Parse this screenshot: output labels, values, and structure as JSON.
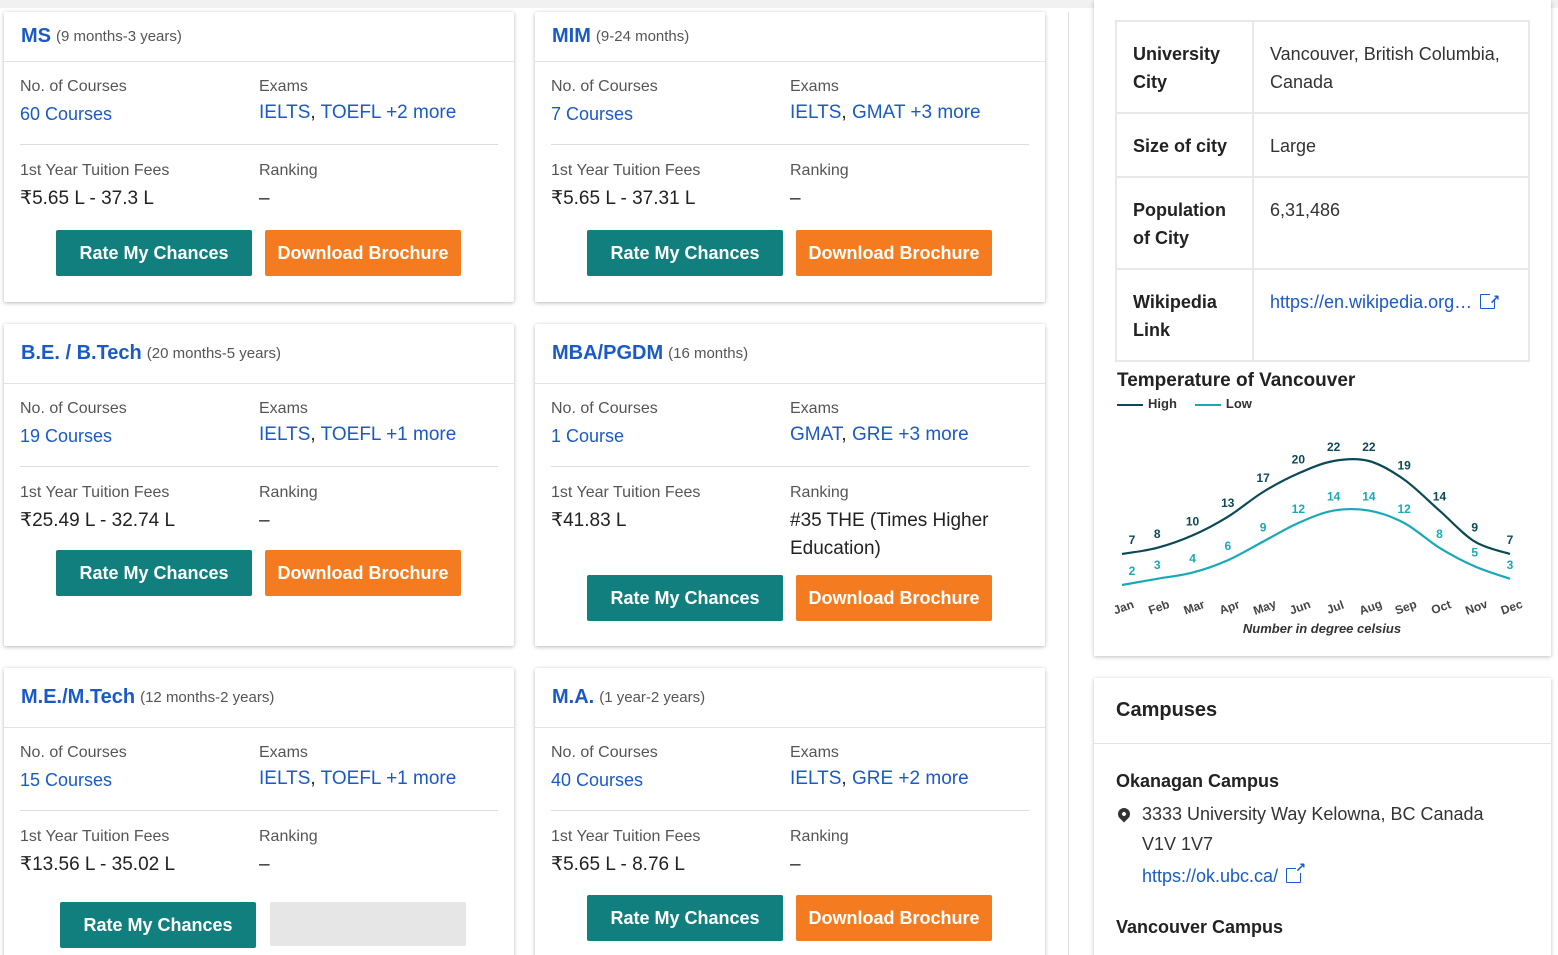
{
  "labels": {
    "no_courses": "No. of Courses",
    "exams": "Exams",
    "fees": "1st Year Tuition Fees",
    "ranking": "Ranking",
    "rate": "Rate My Chances",
    "brochure": "Download Brochure",
    "sep": ", "
  },
  "courses": [
    {
      "title": "MS",
      "duration": "(9 months-3 years)",
      "courses": "60 Courses",
      "exam1": "IELTS",
      "exam2": "TOEFL",
      "more": "+2 more",
      "fees": "₹5.65 L - 37.3 L",
      "ranking": "–"
    },
    {
      "title": "MIM",
      "duration": "(9-24 months)",
      "courses": "7 Courses",
      "exam1": "IELTS",
      "exam2": "GMAT",
      "more": "+3 more",
      "fees": "₹5.65 L - 37.31 L",
      "ranking": "–"
    },
    {
      "title": "B.E. / B.Tech",
      "duration": "(20 months-5 years)",
      "courses": "19 Courses",
      "exam1": "IELTS",
      "exam2": "TOEFL",
      "more": "+1 more",
      "fees": "₹25.49 L - 32.74 L",
      "ranking": "–"
    },
    {
      "title": "MBA/PGDM",
      "duration": "(16 months)",
      "courses": "1 Course",
      "exam1": "GMAT",
      "exam2": "GRE",
      "more": "+3 more",
      "fees": "₹41.83 L",
      "ranking": "#35 THE (Times Higher Education)"
    },
    {
      "title": "M.E./M.Tech",
      "duration": "(12 months-2 years)",
      "courses": "15 Courses",
      "exam1": "IELTS",
      "exam2": "TOEFL",
      "more": "+1 more",
      "fees": "₹13.56 L - 35.02 L",
      "ranking": "–"
    },
    {
      "title": "M.A.",
      "duration": "(1 year-2 years)",
      "courses": "40 Courses",
      "exam1": "IELTS",
      "exam2": "GRE",
      "more": "+2 more",
      "fees": "₹5.65 L - 8.76 L",
      "ranking": "–"
    }
  ],
  "info_table": [
    {
      "key": "University City",
      "value": "Vancouver, British Columbia, Canada"
    },
    {
      "key": "Size of city",
      "value": "Large"
    },
    {
      "key": "Population of City",
      "value": "6,31,486"
    },
    {
      "key": "Wikipedia Link",
      "value": "https://en.wikipedia.org…"
    }
  ],
  "chart_data": {
    "type": "line",
    "title": "Temperature of Vancouver",
    "categories": [
      "Jan",
      "Feb",
      "Mar",
      "Apr",
      "May",
      "Jun",
      "Jul",
      "Aug",
      "Sep",
      "Oct",
      "Nov",
      "Dec"
    ],
    "series": [
      {
        "name": "High",
        "values": [
          7,
          8,
          10,
          13,
          17,
          20,
          22,
          22,
          19,
          14,
          9,
          7
        ],
        "color": "#0b4a55"
      },
      {
        "name": "Low",
        "values": [
          2,
          3,
          4,
          6,
          9,
          12,
          14,
          14,
          12,
          8,
          5,
          3
        ],
        "color": "#17a9b8"
      }
    ],
    "xlabel": "Number in degree celsius",
    "legend": "top-left"
  },
  "campuses": {
    "heading": "Campuses",
    "items": [
      {
        "name": "Okanagan Campus",
        "address": "3333 University Way Kelowna, BC Canada V1V 1V7",
        "link": "https://ok.ubc.ca/"
      },
      {
        "name": "Vancouver Campus"
      }
    ]
  }
}
